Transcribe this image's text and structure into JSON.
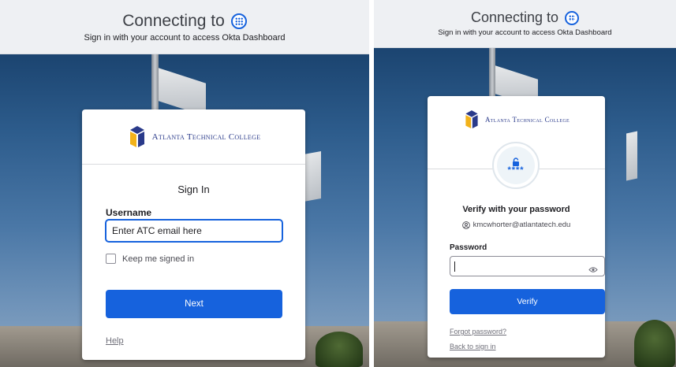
{
  "signin_panel": {
    "header": {
      "title": "Connecting to",
      "subtitle": "Sign in with your account to access Okta Dashboard",
      "icon": "okta-dashboard-icon"
    },
    "logo_text": "Atlanta Technical College",
    "heading": "Sign In",
    "username_label": "Username",
    "username_value": "Enter ATC email here",
    "keep_signed_in_label": "Keep me signed in",
    "keep_signed_in_checked": false,
    "next_label": "Next",
    "help_label": "Help"
  },
  "verify_panel": {
    "header": {
      "title": "Connecting to",
      "subtitle": "Sign in with your account to access Okta Dashboard",
      "icon": "okta-dashboard-icon"
    },
    "logo_text": "Atlanta Technical College",
    "password_badge_text": "****",
    "heading": "Verify with your password",
    "user_email": "kmcwhorter@atlantatech.edu",
    "password_label": "Password",
    "password_value": "",
    "verify_label": "Verify",
    "forgot_password_label": "Forgot password?",
    "back_to_signin_label": "Back to sign in"
  },
  "colors": {
    "primary": "#1662dd",
    "header_bg": "#eef0f3",
    "text": "#1d1d21",
    "link": "#6e6e78",
    "logo_text": "#2a3a8a"
  }
}
